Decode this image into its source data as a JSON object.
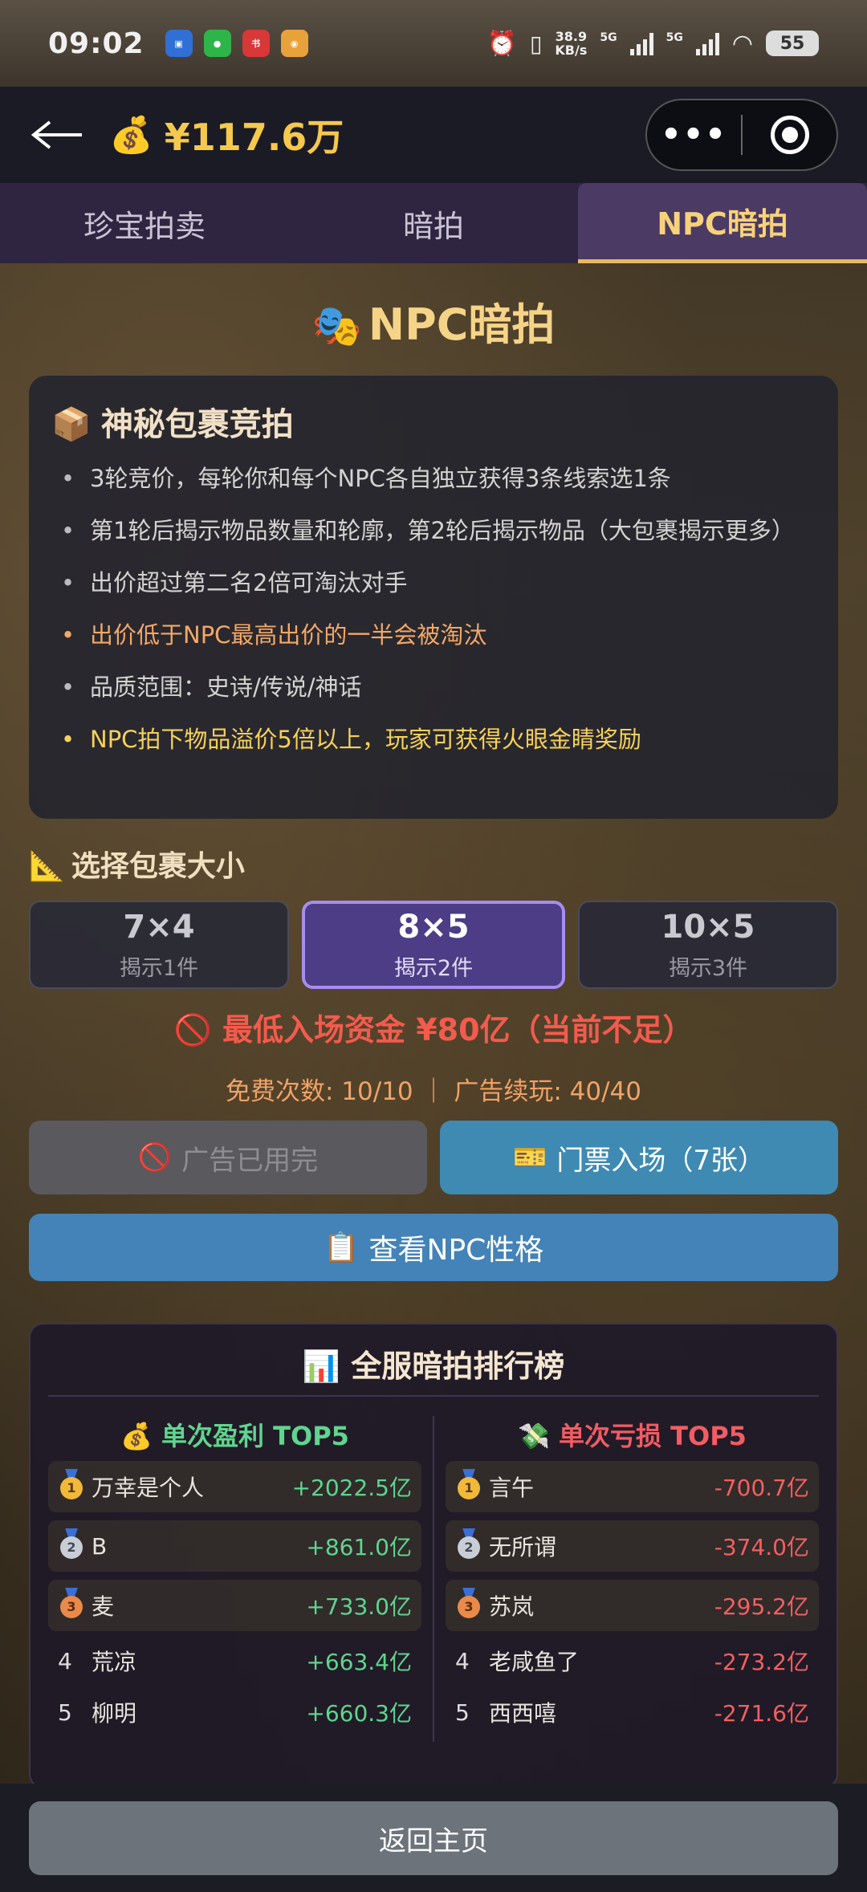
{
  "status_bar": {
    "time": "09:02",
    "speed_value": "38.9",
    "speed_unit": "KB/s",
    "net1": "5G",
    "net2": "5G",
    "battery": "55"
  },
  "header": {
    "money_icon": "money-bag-icon",
    "money": "¥117.6万",
    "menu_dots": "•••"
  },
  "tabs": [
    {
      "label": "珍宝拍卖",
      "active": false
    },
    {
      "label": "暗拍",
      "active": false
    },
    {
      "label": "NPC暗拍",
      "active": true
    }
  ],
  "page": {
    "title_icon": "🎭",
    "title": "NPC暗拍"
  },
  "rules": {
    "icon": "📦",
    "title": "神秘包裹竞拍",
    "items": [
      "3轮竞价，每轮你和每个NPC各自独立获得3条线索选1条",
      "第1轮后揭示物品数量和轮廓，第2轮后揭示物品（大包裹揭示更多）",
      "出价超过第二名2倍可淘汰对手",
      "出价低于NPC最高出价的一半会被淘汰",
      "品质范围：史诗/传说/神话",
      "NPC拍下物品溢价5倍以上，玩家可获得火眼金睛奖励"
    ]
  },
  "size_section": {
    "icon": "📐",
    "label": "选择包裹大小",
    "options": [
      {
        "dim": "7×4",
        "reveal": "揭示1件",
        "selected": false
      },
      {
        "dim": "8×5",
        "reveal": "揭示2件",
        "selected": true
      },
      {
        "dim": "10×5",
        "reveal": "揭示3件",
        "selected": false
      }
    ]
  },
  "entry_warning": "🚫 最低入场资金 ¥80亿（当前不足）",
  "quota_text": "免费次数: 10/10 ｜ 广告续玩: 40/40",
  "buttons": {
    "ad_icon": "🚫",
    "ad_label": "广告已用完",
    "ticket_icon": "🎫",
    "ticket_label": "门票入场（7张）",
    "npc_icon": "📋",
    "npc_label": "查看NPC性格",
    "home_label": "返回主页"
  },
  "leaderboard": {
    "icon": "📊",
    "title": "全服暗拍排行榜",
    "profit": {
      "icon": "💰",
      "title": "单次盈利 TOP5",
      "rows": [
        {
          "rank": "1",
          "name": "万幸是个人",
          "value": "+2022.5亿"
        },
        {
          "rank": "2",
          "name": "B",
          "value": "+861.0亿"
        },
        {
          "rank": "3",
          "name": "麦",
          "value": "+733.0亿"
        },
        {
          "rank": "4",
          "name": "荒凉",
          "value": "+663.4亿"
        },
        {
          "rank": "5",
          "name": "柳明",
          "value": "+660.3亿"
        }
      ]
    },
    "loss": {
      "icon": "💸",
      "title": "单次亏损 TOP5",
      "rows": [
        {
          "rank": "1",
          "name": "言午",
          "value": "-700.7亿"
        },
        {
          "rank": "2",
          "name": "无所谓",
          "value": "-374.0亿"
        },
        {
          "rank": "3",
          "name": "苏岚",
          "value": "-295.2亿"
        },
        {
          "rank": "4",
          "name": "老咸鱼了",
          "value": "-273.2亿"
        },
        {
          "rank": "5",
          "name": "西西嘻",
          "value": "-271.6亿"
        }
      ]
    }
  },
  "colors": {
    "accent_gold": "#f6c84b",
    "profit_green": "#5fd58e",
    "loss_red": "#f26060",
    "selected_purple": "#4c3d86",
    "ticket_blue": "#3e8ab3"
  }
}
